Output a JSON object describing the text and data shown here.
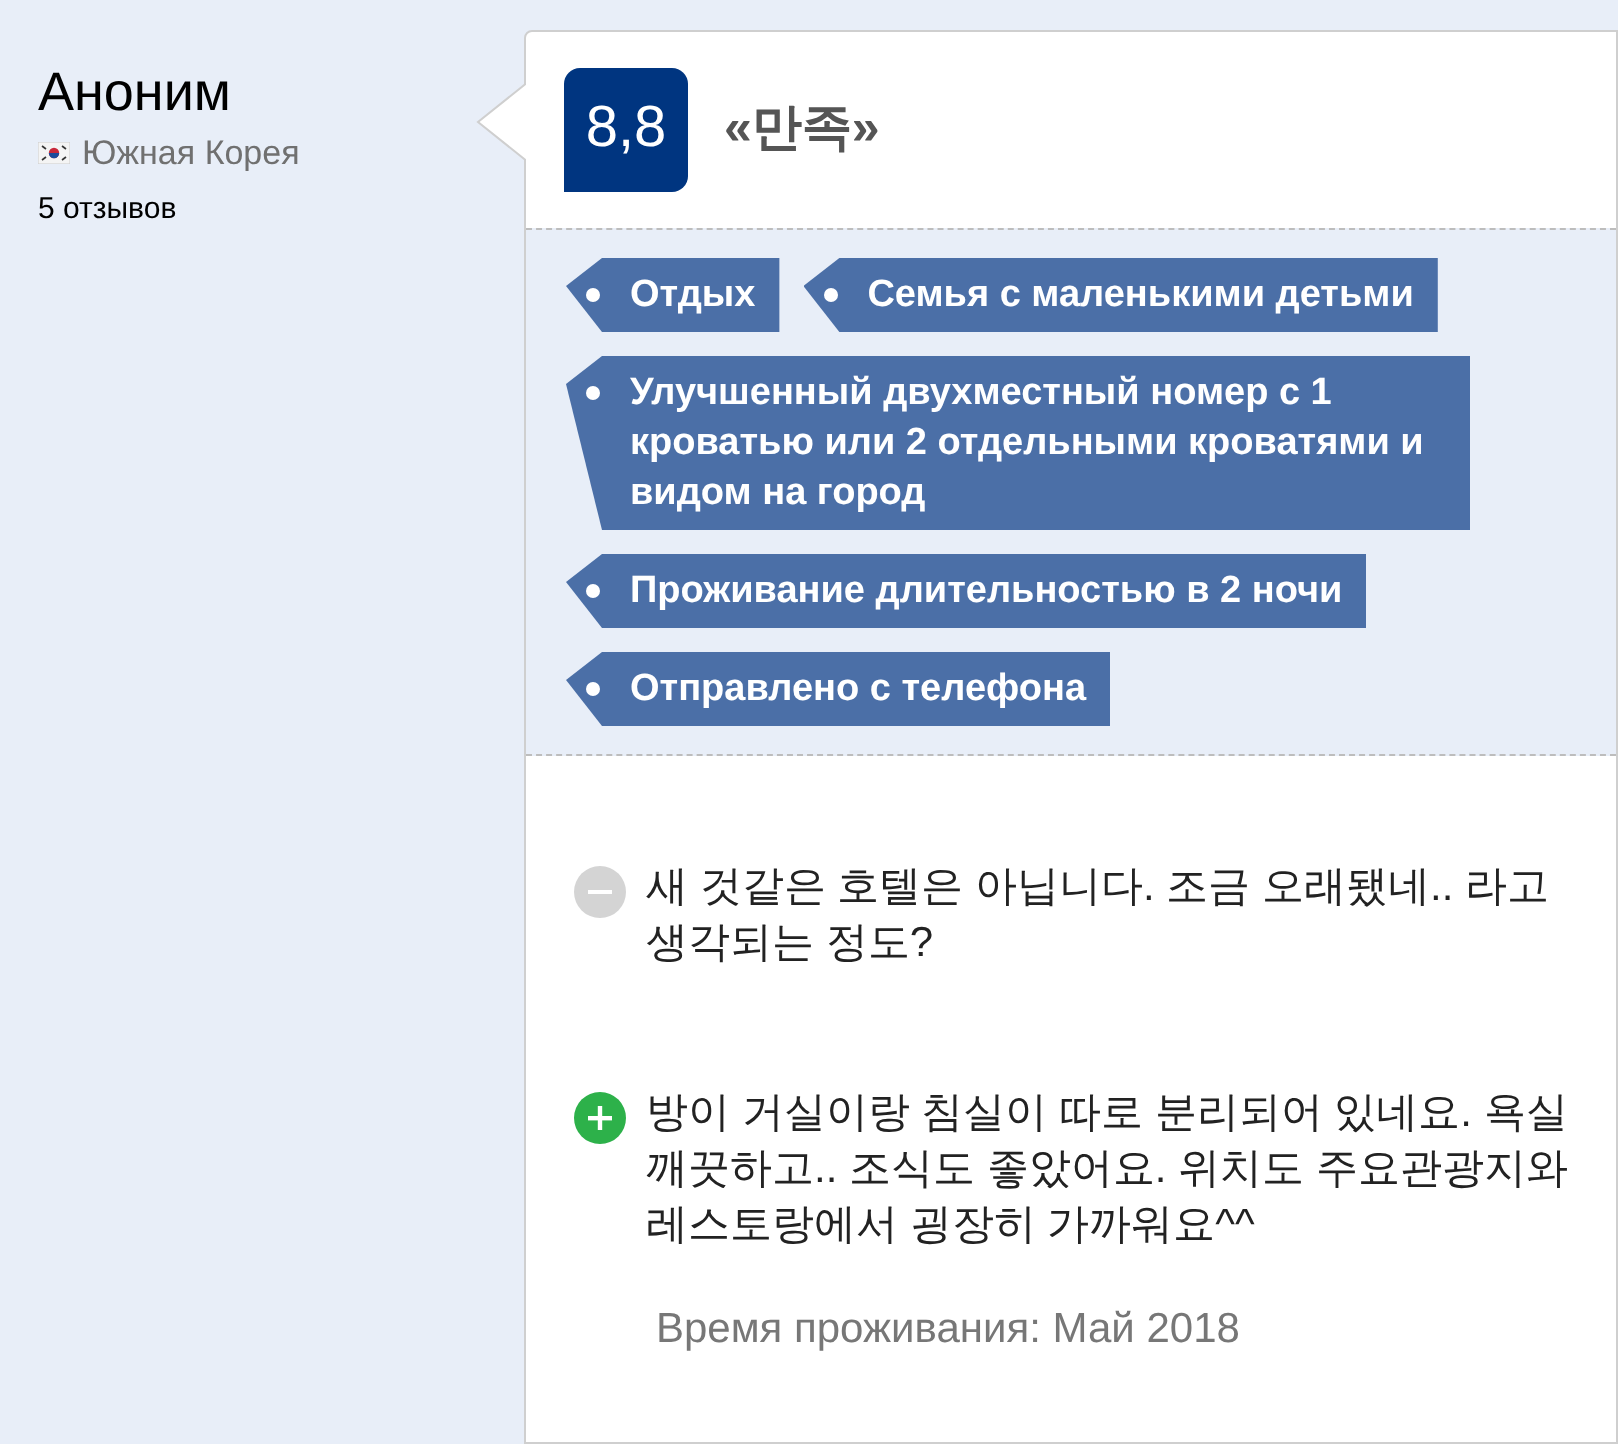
{
  "reviewer": {
    "name": "Аноним",
    "country": "Южная Корея",
    "review_count": "5 отзывов"
  },
  "score": "8,8",
  "headline": "«만족»",
  "tags": [
    "Отдых",
    "Семья с маленькими детьми",
    "Улучшенный двухместный номер с 1 кроватью или 2 отдельными кроватями и видом на город",
    "Проживание длительностью в 2 ночи",
    "Отправлено с телефона"
  ],
  "comments": [
    {
      "kind": "negative",
      "text": "새 것같은 호텔은 아닙니다. 조금 오래됐네.. 라고 생각되는 정도?"
    },
    {
      "kind": "positive",
      "text": "방이 거실이랑 침실이 따로 분리되어 있네요. 욕실 깨끗하고.. 조식도 좋았어요. 위치도 주요관광지와 레스토랑에서 굉장히 가까워요^^"
    }
  ],
  "stay_date": "Время проживания: Май 2018"
}
